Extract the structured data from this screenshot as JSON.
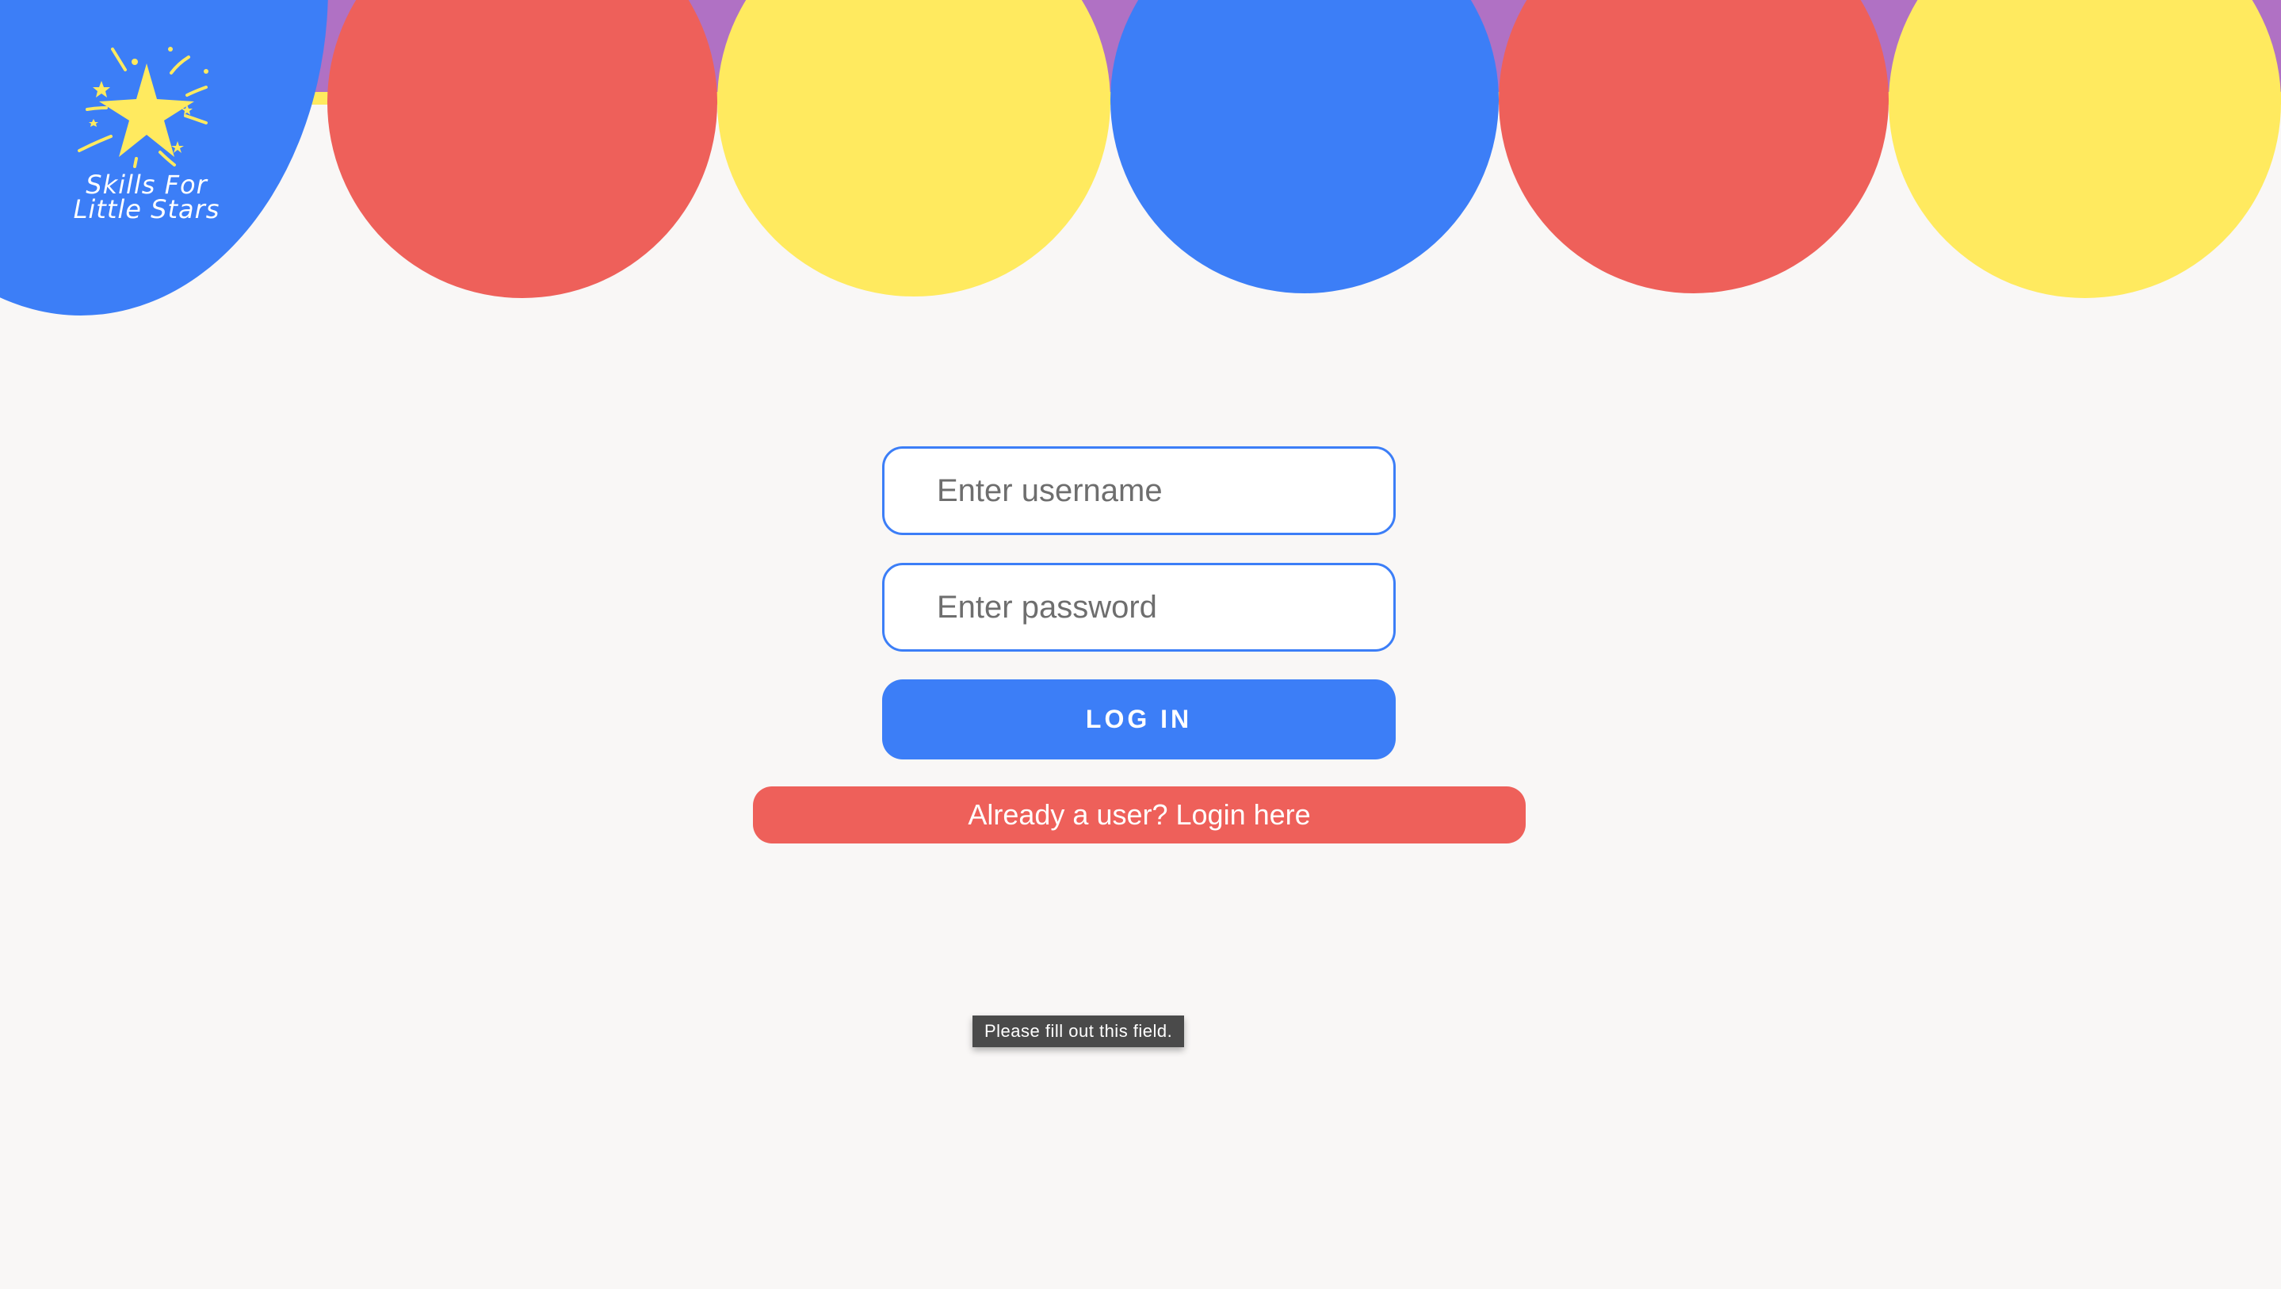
{
  "brand": {
    "name_line1": "Skills For",
    "name_line2": "Little Stars",
    "logo_icon": "star-burst-icon"
  },
  "colors": {
    "banner_purple": "#b071c4",
    "yellow": "#ffea5f",
    "red": "#ee605a",
    "blue": "#3c7ef7",
    "background": "#f9f7f6"
  },
  "login_form": {
    "username_placeholder": "Enter username",
    "username_value": "",
    "password_placeholder": "Enter password",
    "password_value": "",
    "login_button_label": "LOG IN",
    "already_user_label": "Already a user? Login here"
  },
  "validation_tooltip": {
    "text": "Please fill out this field."
  }
}
